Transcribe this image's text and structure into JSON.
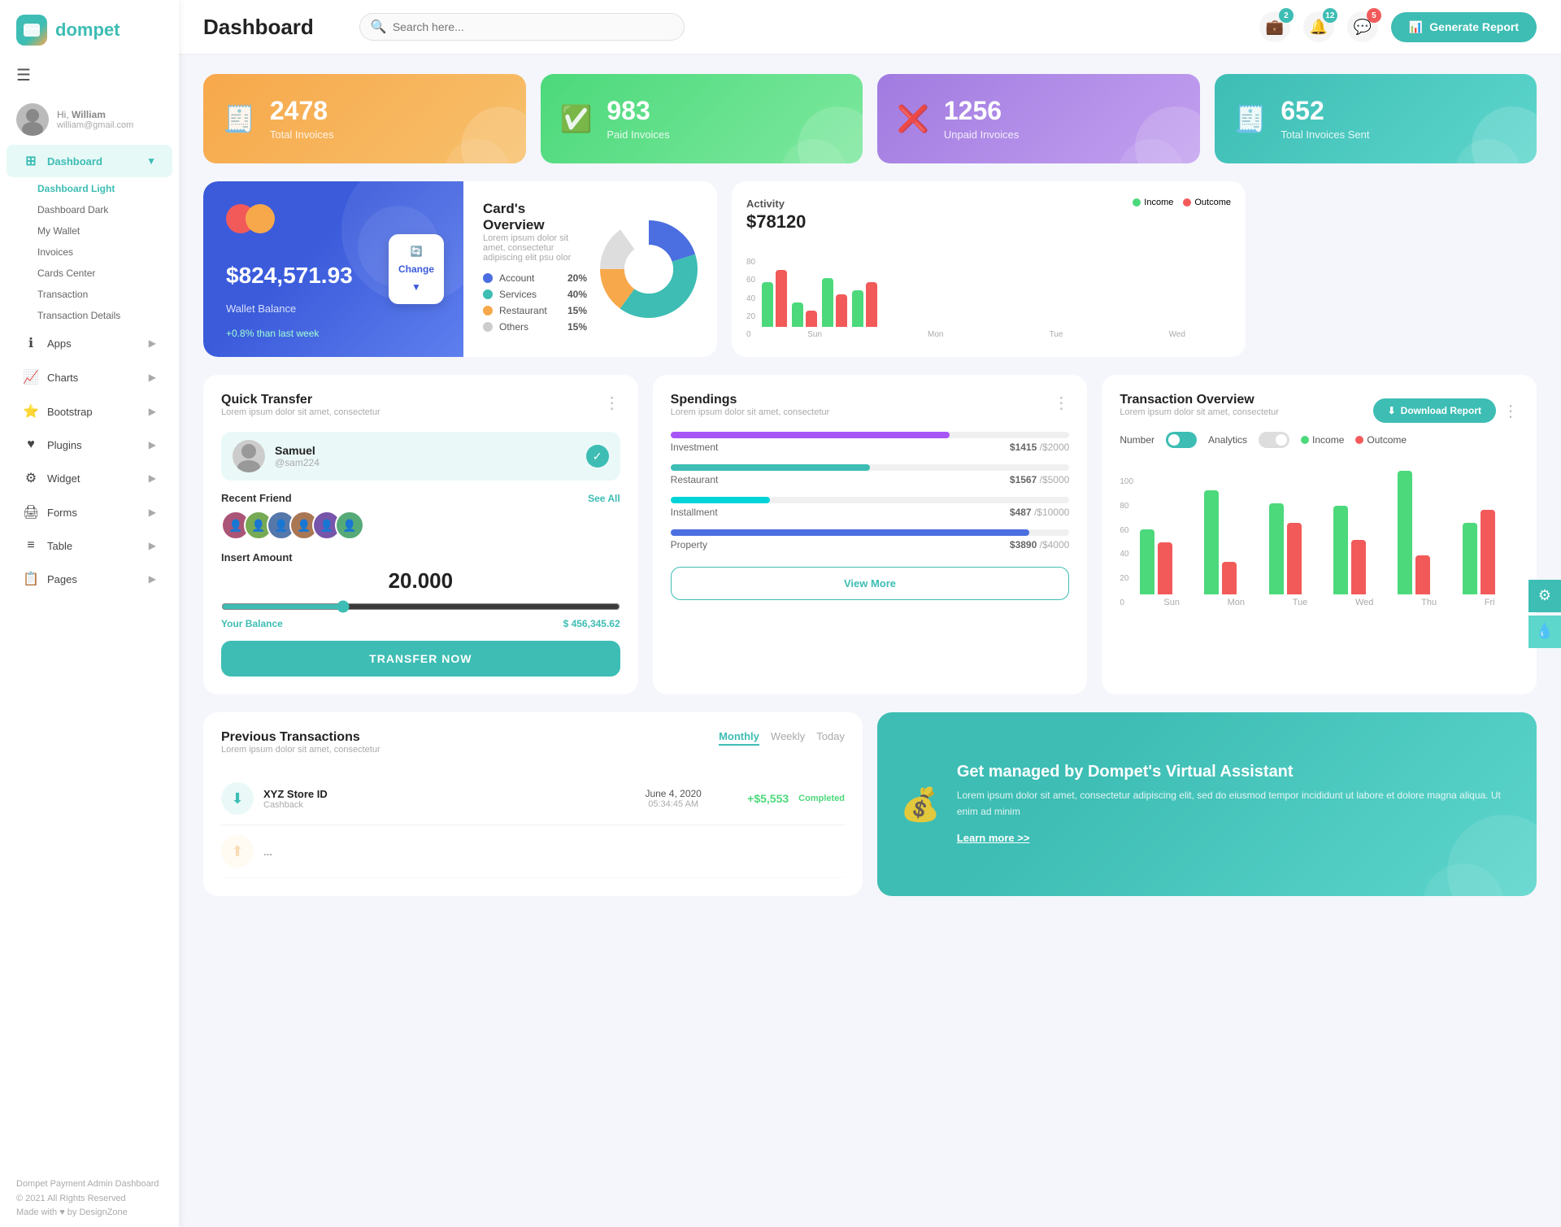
{
  "app": {
    "logo_text": "dompet",
    "header_title": "Dashboard",
    "search_placeholder": "Search here...",
    "generate_btn": "Generate Report"
  },
  "header_icons": {
    "wallet_badge": "2",
    "bell_badge": "12",
    "chat_badge": "5"
  },
  "sidebar": {
    "user_hi": "Hi,",
    "user_name": "William",
    "user_email": "william@gmail.com",
    "nav_items": [
      {
        "label": "Dashboard",
        "icon": "⊞",
        "active": true,
        "has_arrow": true
      },
      {
        "label": "Apps",
        "icon": "ℹ",
        "active": false,
        "has_arrow": true
      },
      {
        "label": "Charts",
        "icon": "📈",
        "active": false,
        "has_arrow": true
      },
      {
        "label": "Bootstrap",
        "icon": "⭐",
        "active": false,
        "has_arrow": true
      },
      {
        "label": "Plugins",
        "icon": "♥",
        "active": false,
        "has_arrow": true
      },
      {
        "label": "Widget",
        "icon": "⚙",
        "active": false,
        "has_arrow": true
      },
      {
        "label": "Forms",
        "icon": "🖨",
        "active": false,
        "has_arrow": true
      },
      {
        "label": "Table",
        "icon": "≡",
        "active": false,
        "has_arrow": true
      },
      {
        "label": "Pages",
        "icon": "📋",
        "active": false,
        "has_arrow": true
      }
    ],
    "sub_items": [
      {
        "label": "Dashboard Light",
        "active": true
      },
      {
        "label": "Dashboard Dark",
        "active": false
      },
      {
        "label": "My Wallet",
        "active": false
      },
      {
        "label": "Invoices",
        "active": false
      },
      {
        "label": "Cards Center",
        "active": false
      },
      {
        "label": "Transaction",
        "active": false
      },
      {
        "label": "Transaction Details",
        "active": false
      }
    ],
    "footer_text": "Dompet Payment Admin Dashboard",
    "footer_year": "© 2021 All Rights Reserved",
    "footer_credit": "Made with ♥ by DesignZone"
  },
  "stat_cards": [
    {
      "value": "2478",
      "label": "Total Invoices",
      "type": "orange",
      "icon": "🧾"
    },
    {
      "value": "983",
      "label": "Paid Invoices",
      "type": "green",
      "icon": "✅"
    },
    {
      "value": "1256",
      "label": "Unpaid Invoices",
      "type": "purple",
      "icon": "❌"
    },
    {
      "value": "652",
      "label": "Total Invoices Sent",
      "type": "teal",
      "icon": "🧾"
    }
  ],
  "wallet": {
    "balance": "$824,571.93",
    "label": "Wallet Balance",
    "change": "+0.8% than last week",
    "change_btn": "Change"
  },
  "cards_overview": {
    "title": "Card's Overview",
    "desc": "Lorem ipsum dolor sit amet, consectetur adipiscing elit psu olor",
    "items": [
      {
        "label": "Account",
        "pct": "20%",
        "color": "#4b6ee0"
      },
      {
        "label": "Services",
        "pct": "40%",
        "color": "#3dbdb4"
      },
      {
        "label": "Restaurant",
        "pct": "15%",
        "color": "#f7a84b"
      },
      {
        "label": "Others",
        "pct": "15%",
        "color": "#ccc"
      }
    ]
  },
  "activity": {
    "label": "Activity",
    "amount": "$78120",
    "legend": [
      {
        "label": "Income",
        "color": "#4cd97b"
      },
      {
        "label": "Outcome",
        "color": "#f25a5a"
      }
    ],
    "bars": [
      {
        "income": 55,
        "outcome": 70,
        "day": "Sun"
      },
      {
        "income": 30,
        "outcome": 20,
        "day": "Mon"
      },
      {
        "income": 60,
        "outcome": 40,
        "day": "Tue"
      },
      {
        "income": 45,
        "outcome": 55,
        "day": "Wed"
      }
    ]
  },
  "quick_transfer": {
    "title": "Quick Transfer",
    "desc": "Lorem ipsum dolor sit amet, consectetur",
    "contact": {
      "name": "Samuel",
      "id": "@sam224"
    },
    "recent_friends_label": "Recent Friend",
    "see_all": "See All",
    "insert_amount_label": "Insert Amount",
    "amount": "20.000",
    "balance_label": "Your Balance",
    "balance": "$ 456,345.62",
    "btn": "TRANSFER NOW"
  },
  "spendings": {
    "title": "Spendings",
    "desc": "Lorem ipsum dolor sit amet, consectetur",
    "items": [
      {
        "label": "Investment",
        "current": "$1415",
        "total": "$2000",
        "pct": 70,
        "color": "#a855f7"
      },
      {
        "label": "Restaurant",
        "current": "$1567",
        "total": "$5000",
        "pct": 50,
        "color": "#3dbdb4"
      },
      {
        "label": "Installment",
        "current": "$487",
        "total": "$10000",
        "pct": 25,
        "color": "#00d4d8"
      },
      {
        "label": "Property",
        "current": "$3890",
        "total": "$4000",
        "pct": 90,
        "color": "#4b6ee0"
      }
    ],
    "btn": "View More"
  },
  "transaction_overview": {
    "title": "Transaction Overview",
    "desc": "Lorem ipsum dolor sit amet, consectetur",
    "download_btn": "Download Report",
    "toggle_number": "Number",
    "toggle_analytics": "Analytics",
    "legend": [
      {
        "label": "Income",
        "color": "#4cd97b"
      },
      {
        "label": "Outcome",
        "color": "#f25a5a"
      }
    ],
    "bars": [
      {
        "income": 50,
        "outcome": 40,
        "day": "Sun"
      },
      {
        "income": 80,
        "outcome": 25,
        "day": "Mon"
      },
      {
        "income": 70,
        "outcome": 55,
        "day": "Tue"
      },
      {
        "income": 68,
        "outcome": 42,
        "day": "Wed"
      },
      {
        "income": 95,
        "outcome": 30,
        "day": "Thu"
      },
      {
        "income": 55,
        "outcome": 65,
        "day": "Fri"
      }
    ],
    "y_labels": [
      "0",
      "20",
      "40",
      "60",
      "80",
      "100"
    ]
  },
  "prev_transactions": {
    "title": "Previous Transactions",
    "desc": "Lorem ipsum dolor sit amet, consectetur",
    "tabs": [
      "Monthly",
      "Weekly",
      "Today"
    ],
    "active_tab": "Monthly",
    "rows": [
      {
        "name": "XYZ Store ID",
        "type": "Cashback",
        "date": "June 4, 2020",
        "time": "05:34:45 AM",
        "amount": "+$5,553",
        "status": "Completed",
        "icon": "⬇"
      }
    ]
  },
  "va_card": {
    "title": "Get managed by Dompet's Virtual Assistant",
    "desc": "Lorem ipsum dolor sit amet, consectetur adipiscing elit, sed do eiusmod tempor incididunt ut labore et dolore magna aliqua. Ut enim ad minim",
    "link": "Learn more >>"
  }
}
